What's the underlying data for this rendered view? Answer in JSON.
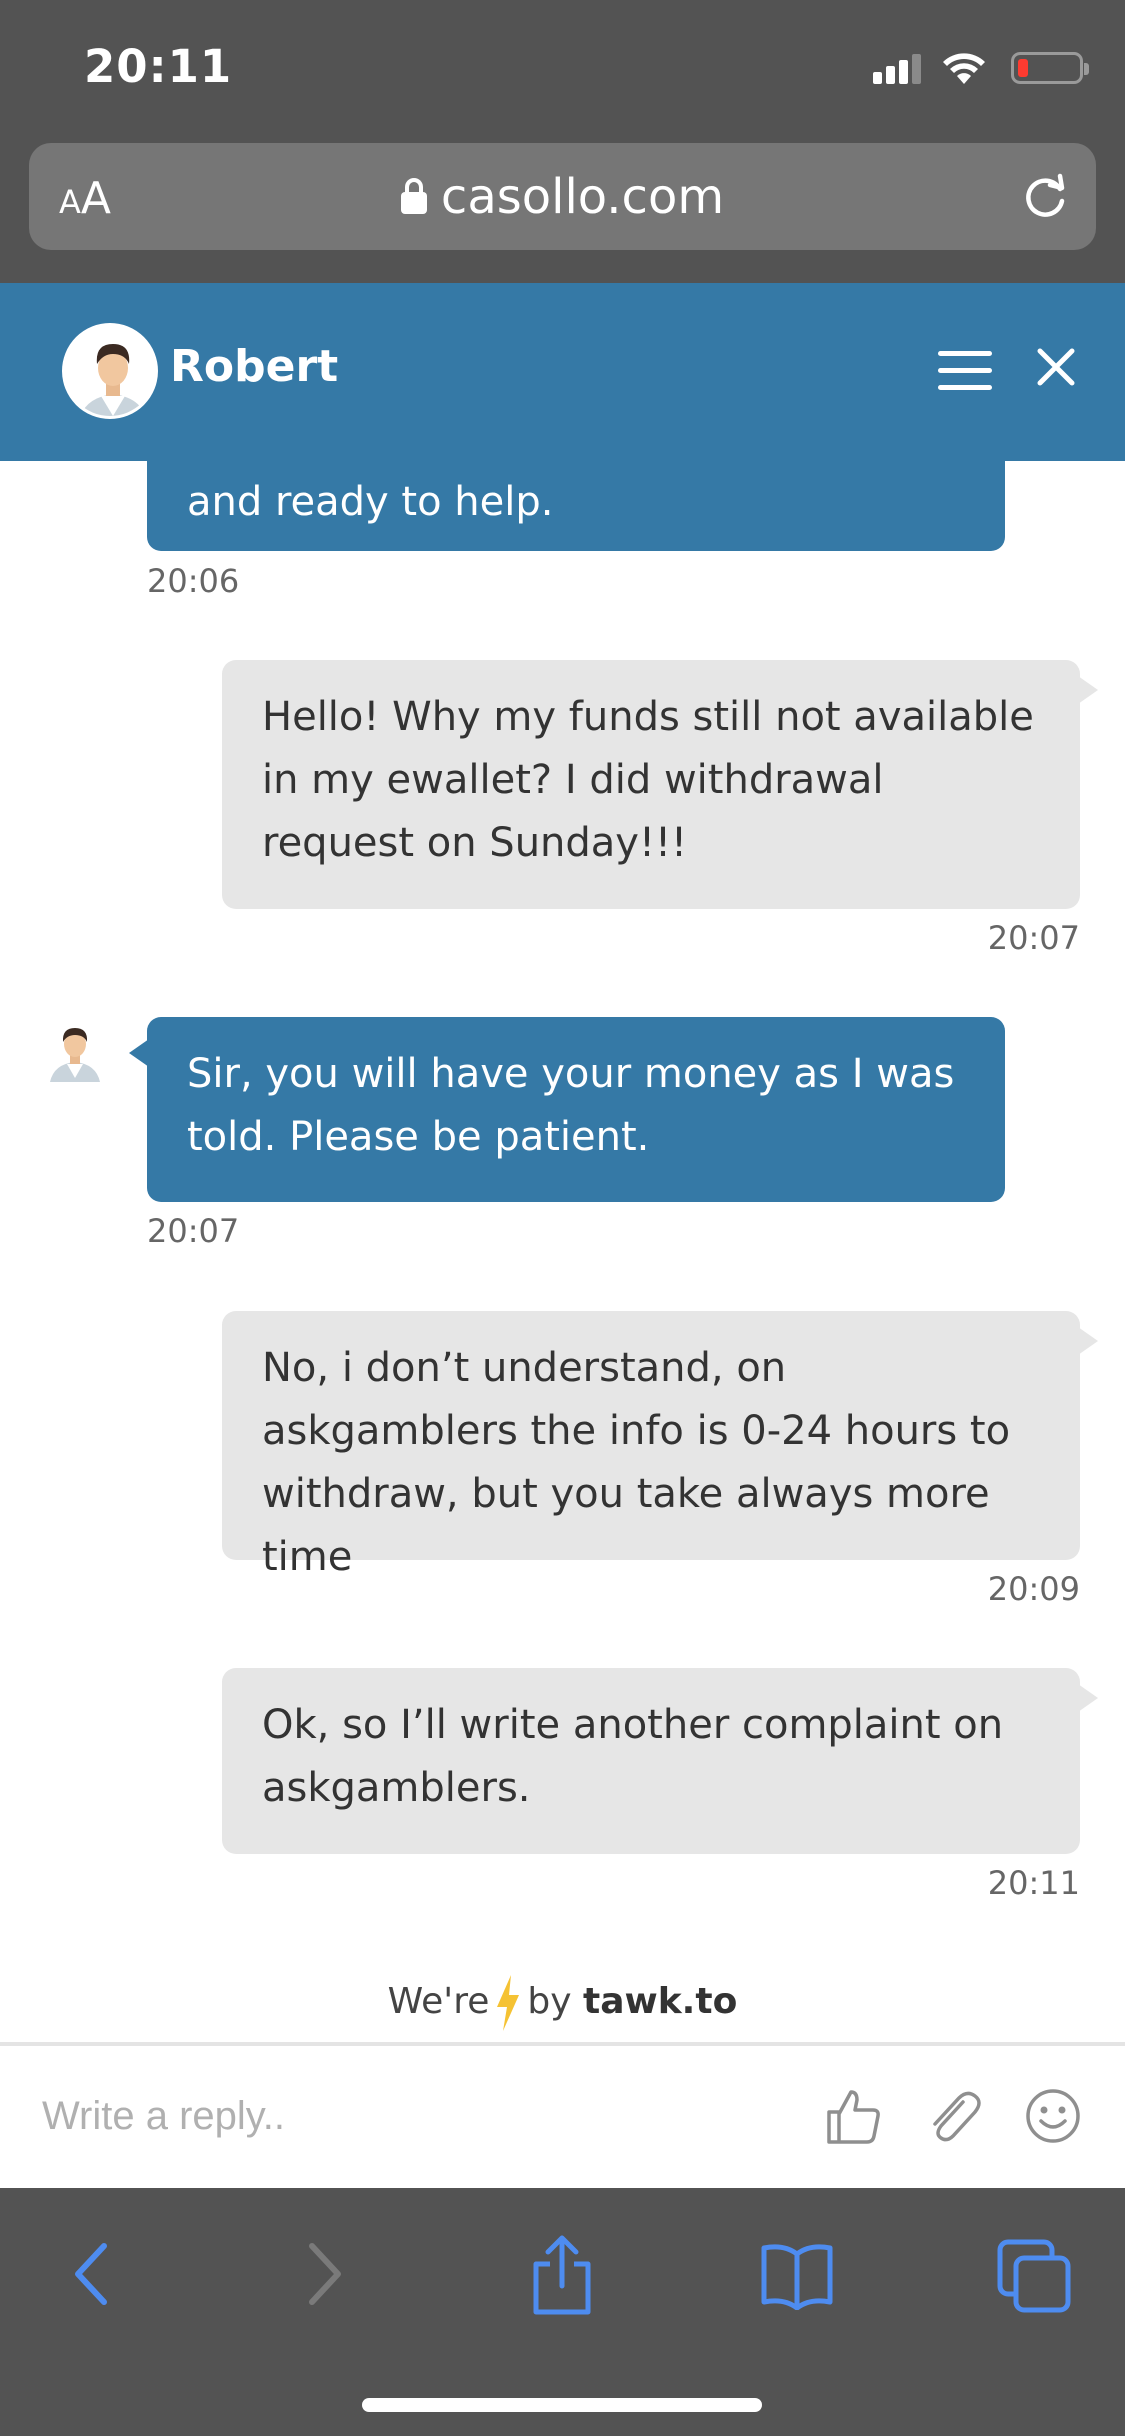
{
  "status_bar": {
    "time": "20:11",
    "battery_color": "#ff3b30"
  },
  "browser": {
    "text_size_small": "A",
    "text_size_large": "A",
    "url": "casollo.com"
  },
  "chat": {
    "agent_name": "Robert",
    "header_color": "#3579a6",
    "messages": [
      {
        "from": "agent",
        "text": "and ready to help.",
        "time": "20:06"
      },
      {
        "from": "user",
        "text": "Hello! Why my funds still not available in my ewallet? I did withdrawal request on Sunday!!!",
        "time": "20:07"
      },
      {
        "from": "agent",
        "text": "Sir, you will have your money as I was told. Please be patient.",
        "time": "20:07"
      },
      {
        "from": "user",
        "text": "No, i don’t understand, on askgamblers the info is 0-24 hours to withdraw, but you take always more time",
        "time": "20:09"
      },
      {
        "from": "user",
        "text": "Ok, so I’ll write another complaint on askgamblers.",
        "time": "20:11"
      }
    ]
  },
  "powered_by": {
    "prefix": "We're",
    "middle": "by",
    "brand": "tawk.to"
  },
  "reply": {
    "placeholder": "Write a reply.."
  },
  "icons": {
    "header": [
      "menu-icon",
      "close-icon"
    ],
    "reply": [
      "thumbs-up-icon",
      "paperclip-icon",
      "smiley-icon"
    ],
    "bottom": [
      "back-icon",
      "forward-icon",
      "share-icon",
      "bookmarks-icon",
      "tabs-icon"
    ]
  }
}
